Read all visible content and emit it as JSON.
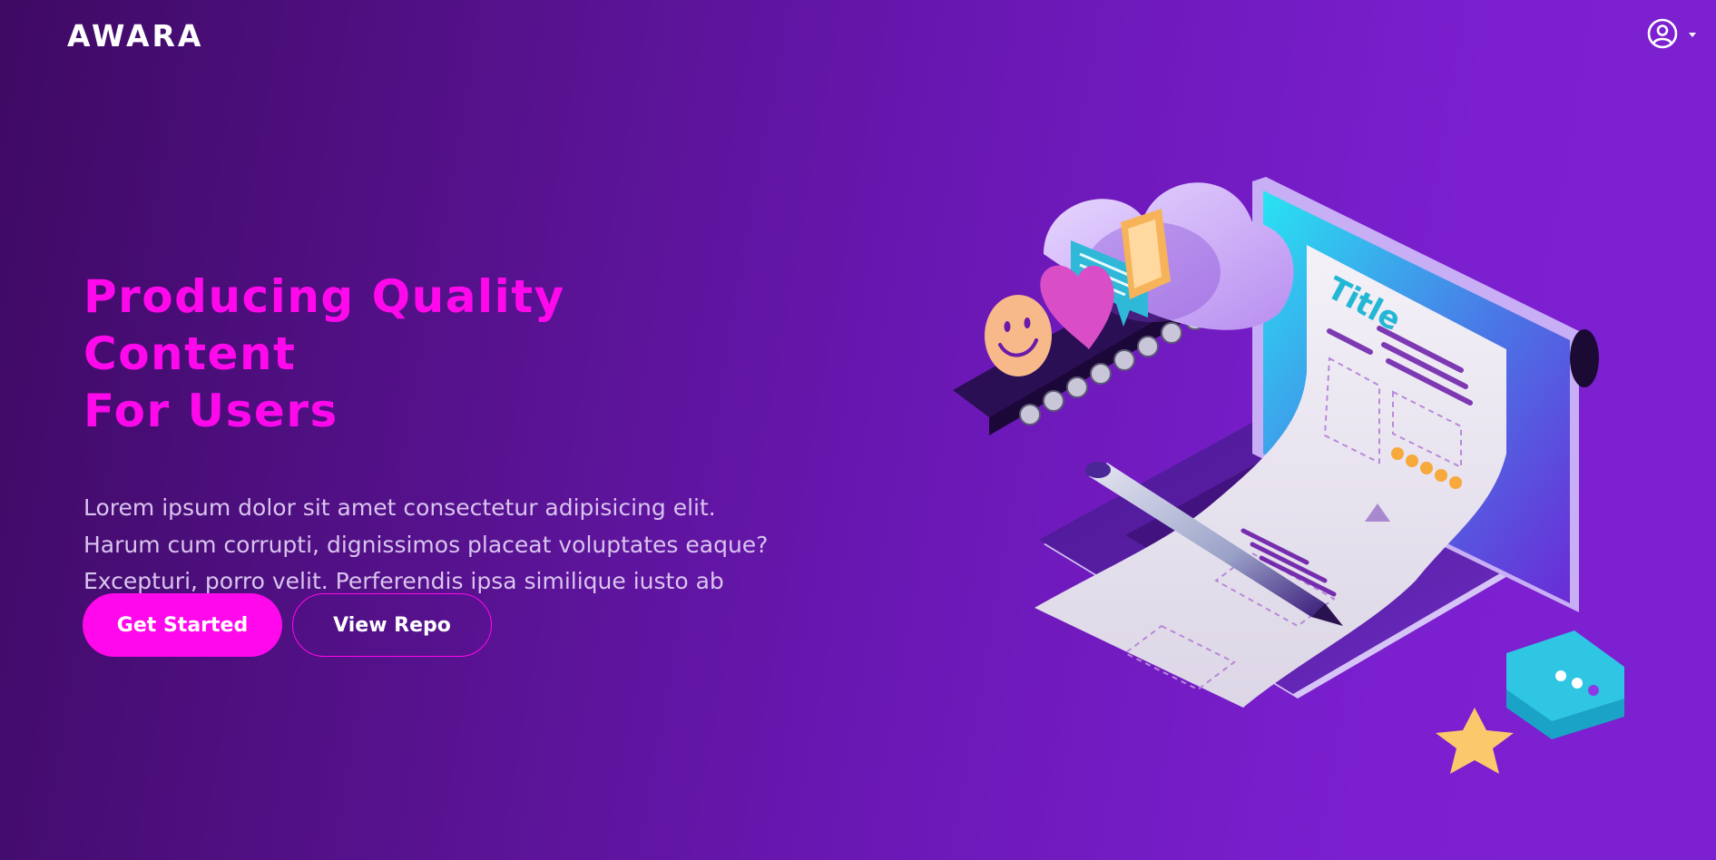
{
  "nav": {
    "logo": "AWARA"
  },
  "hero": {
    "title_line1": "Producing Quality Content",
    "title_line2": "For Users",
    "description": "Lorem ipsum dolor sit amet consectetur adipisicing elit. Harum cum corrupti, dignissimos placeat voluptates eaque? Excepturi, porro velit. Perferendis ipsa similique iusto ab mollitia iure.",
    "primary_button": "Get Started",
    "secondary_button": "View Repo"
  },
  "illustration": {
    "document_title": "Title"
  },
  "colors": {
    "accent": "#ff08ec",
    "background_start": "#3e0a63",
    "background_end": "#7d20d2",
    "body_text": "#d9c4ef"
  },
  "icons": [
    "user-circle-icon",
    "caret-down-icon"
  ]
}
